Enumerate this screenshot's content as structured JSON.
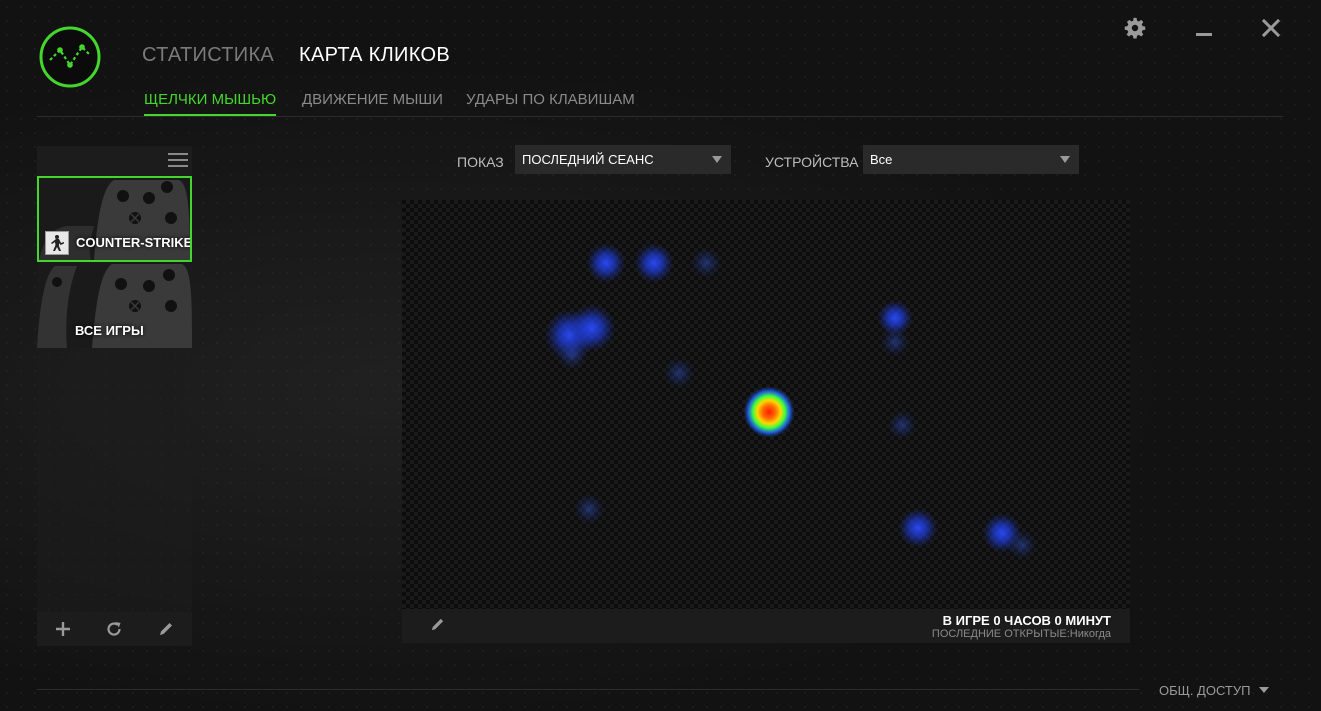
{
  "header": {
    "tabs": [
      {
        "label": "СТАТИСТИКА",
        "active": false
      },
      {
        "label": "КАРТА КЛИКОВ",
        "active": true
      }
    ],
    "subtabs": [
      {
        "label": "ЩЕЛЧКИ МЫШЬЮ",
        "active": true
      },
      {
        "label": "ДВИЖЕНИЕ МЫШИ",
        "active": false
      },
      {
        "label": "УДАРЫ ПО КЛАВИШАМ",
        "active": false
      }
    ]
  },
  "window_controls": {
    "icons": [
      "gear-icon",
      "minimize-icon",
      "close-icon"
    ]
  },
  "sidebar": {
    "games": [
      {
        "label": "COUNTER-STRIKE",
        "selected": true,
        "icon": "counter-strike-icon"
      },
      {
        "label": "ВСЕ ИГРЫ",
        "selected": false
      }
    ],
    "footer_icons": [
      "plus-icon",
      "refresh-icon",
      "pencil-icon"
    ]
  },
  "filters": {
    "show_label": "ПОКАЗ",
    "show_value": "ПОСЛЕДНИЙ СЕАНС",
    "devices_label": "УСТРОЙСТВА",
    "devices_value": "Все"
  },
  "heatmap_info": {
    "in_game": "В ИГРЕ 0 ЧАСОВ 0 МИНУТ",
    "last_opened": "ПОСЛЕДНИЕ ОТКРЫТЫЕ:Никогда"
  },
  "footer": {
    "share_label": "ОБЩ. ДОСТУП"
  },
  "colors": {
    "accent": "#44d62c",
    "heat_low": "#1a3cff",
    "heat_high": "#ff2a00"
  }
}
